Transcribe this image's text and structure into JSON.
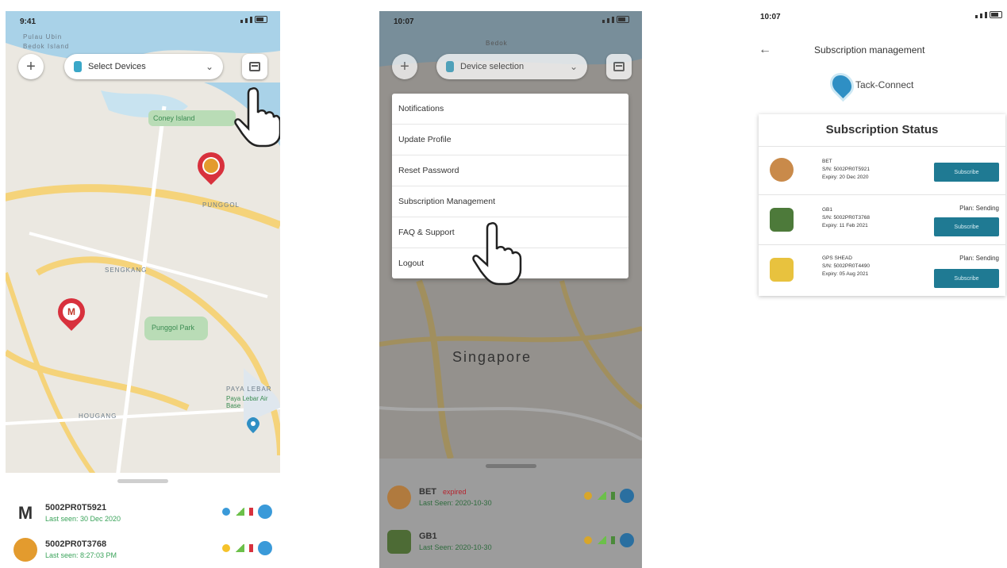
{
  "screen1": {
    "status_time": "9:41",
    "map_labels": [
      "Pulau Ubin",
      "Bedok Island",
      "PUNGGOL",
      "SENGKANG",
      "HOUGANG",
      "PAYA LEBAR"
    ],
    "park_labels": [
      "Coney Island",
      "Punggol Park",
      "Paya Lebar Air Base"
    ],
    "device_dropdown": "Select Devices",
    "devices": [
      {
        "name": "5002PR0T5921",
        "sub": "Last seen: 30 Dec 2020"
      },
      {
        "name": "5002PR0T3768",
        "sub": "Last seen: 8:27:03 PM"
      }
    ]
  },
  "screen2": {
    "status_time": "10:07",
    "top_label": "Bedok",
    "device_dropdown": "Device selection",
    "menu_items": [
      "Notifications",
      "Update Profile",
      "Reset Password",
      "Subscription Management",
      "FAQ & Support",
      "Logout"
    ],
    "city_label": "Singapore",
    "devices": [
      {
        "name": "BET",
        "status": "expired",
        "sub": "Last Seen: 2020-10-30"
      },
      {
        "name": "GB1",
        "sub": "Last Seen: 2020-10-30"
      }
    ]
  },
  "screen3": {
    "status_time": "10:07",
    "back_icon": "←",
    "title": "Subscription management",
    "brand": "Tack-Connect",
    "card_title": "Subscription Status",
    "rows": [
      {
        "lines": [
          "BET",
          "S/N: 5002PR0T5921",
          "Expiry: 20 Dec 2020"
        ],
        "plan": "",
        "button": "Subscribe"
      },
      {
        "lines": [
          "GB1",
          "S/N: 5002PR0T3768",
          "Expiry: 11 Feb 2021"
        ],
        "plan": "Plan: Sending",
        "button": "Subscribe"
      },
      {
        "lines": [
          "GPS SHEAD",
          "S/N: 5002PR0T4490",
          "Expiry: 05 Aug 2021"
        ],
        "plan": "Plan: Sending",
        "button": "Subscribe"
      }
    ]
  },
  "colors": {
    "pin": "#d8313d",
    "button": "#1f7a93",
    "water": "#a9d2e8",
    "road": "#f5d37a",
    "park": "#b9dcb6"
  }
}
